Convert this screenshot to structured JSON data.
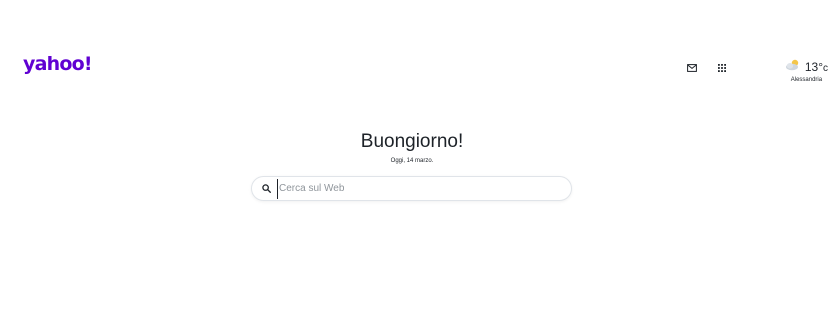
{
  "header": {
    "logo_text": "yahoo!",
    "mail_icon": "mail-icon",
    "apps_icon": "apps-grid-icon",
    "weather": {
      "icon": "partly-cloudy-icon",
      "temperature": "13°",
      "unit": "c",
      "city": "Alessandria"
    }
  },
  "main": {
    "greeting": "Buongiorno!",
    "date": "Oggi, 14 marzo.",
    "search": {
      "placeholder": "Cerca sul Web",
      "value": ""
    }
  },
  "colors": {
    "brand": "#6001d2",
    "text": "#1d2228",
    "border": "#e0e4e9"
  }
}
